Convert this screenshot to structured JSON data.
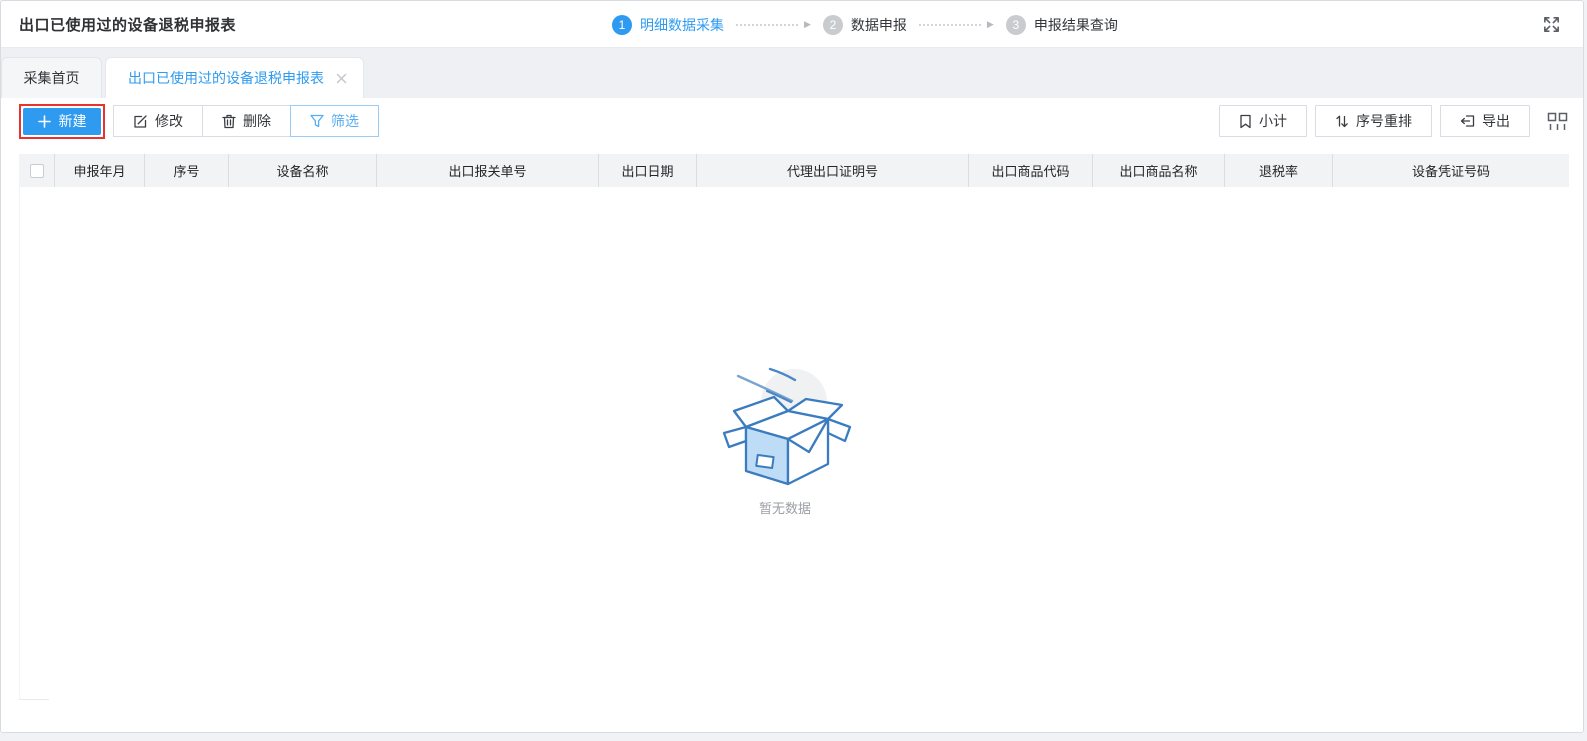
{
  "page": {
    "title": "出口已使用过的设备退税申报表"
  },
  "stepper": {
    "steps": [
      {
        "num": "1",
        "label": "明细数据采集",
        "active": true
      },
      {
        "num": "2",
        "label": "数据申报",
        "active": false
      },
      {
        "num": "3",
        "label": "申报结果查询",
        "active": false
      }
    ]
  },
  "tabs": [
    {
      "label": "采集首页",
      "active": false
    },
    {
      "label": "出口已使用过的设备退税申报表",
      "active": true,
      "closable": true
    }
  ],
  "toolbar": {
    "new_label": "新建",
    "edit_label": "修改",
    "delete_label": "删除",
    "filter_label": "筛选",
    "subtotal_label": "小计",
    "renumber_label": "序号重排",
    "export_label": "导出"
  },
  "table": {
    "columns": [
      "申报年月",
      "序号",
      "设备名称",
      "出口报关单号",
      "出口日期",
      "代理出口证明号",
      "出口商品代码",
      "出口商品名称",
      "退税率",
      "设备凭证号码"
    ],
    "rows": []
  },
  "empty": {
    "text": "暂无数据"
  },
  "colors": {
    "primary": "#2e9bf0",
    "annotation_highlight": "#e8322e",
    "step_inactive": "#c9cbce",
    "header_bg": "#f2f3f5"
  }
}
